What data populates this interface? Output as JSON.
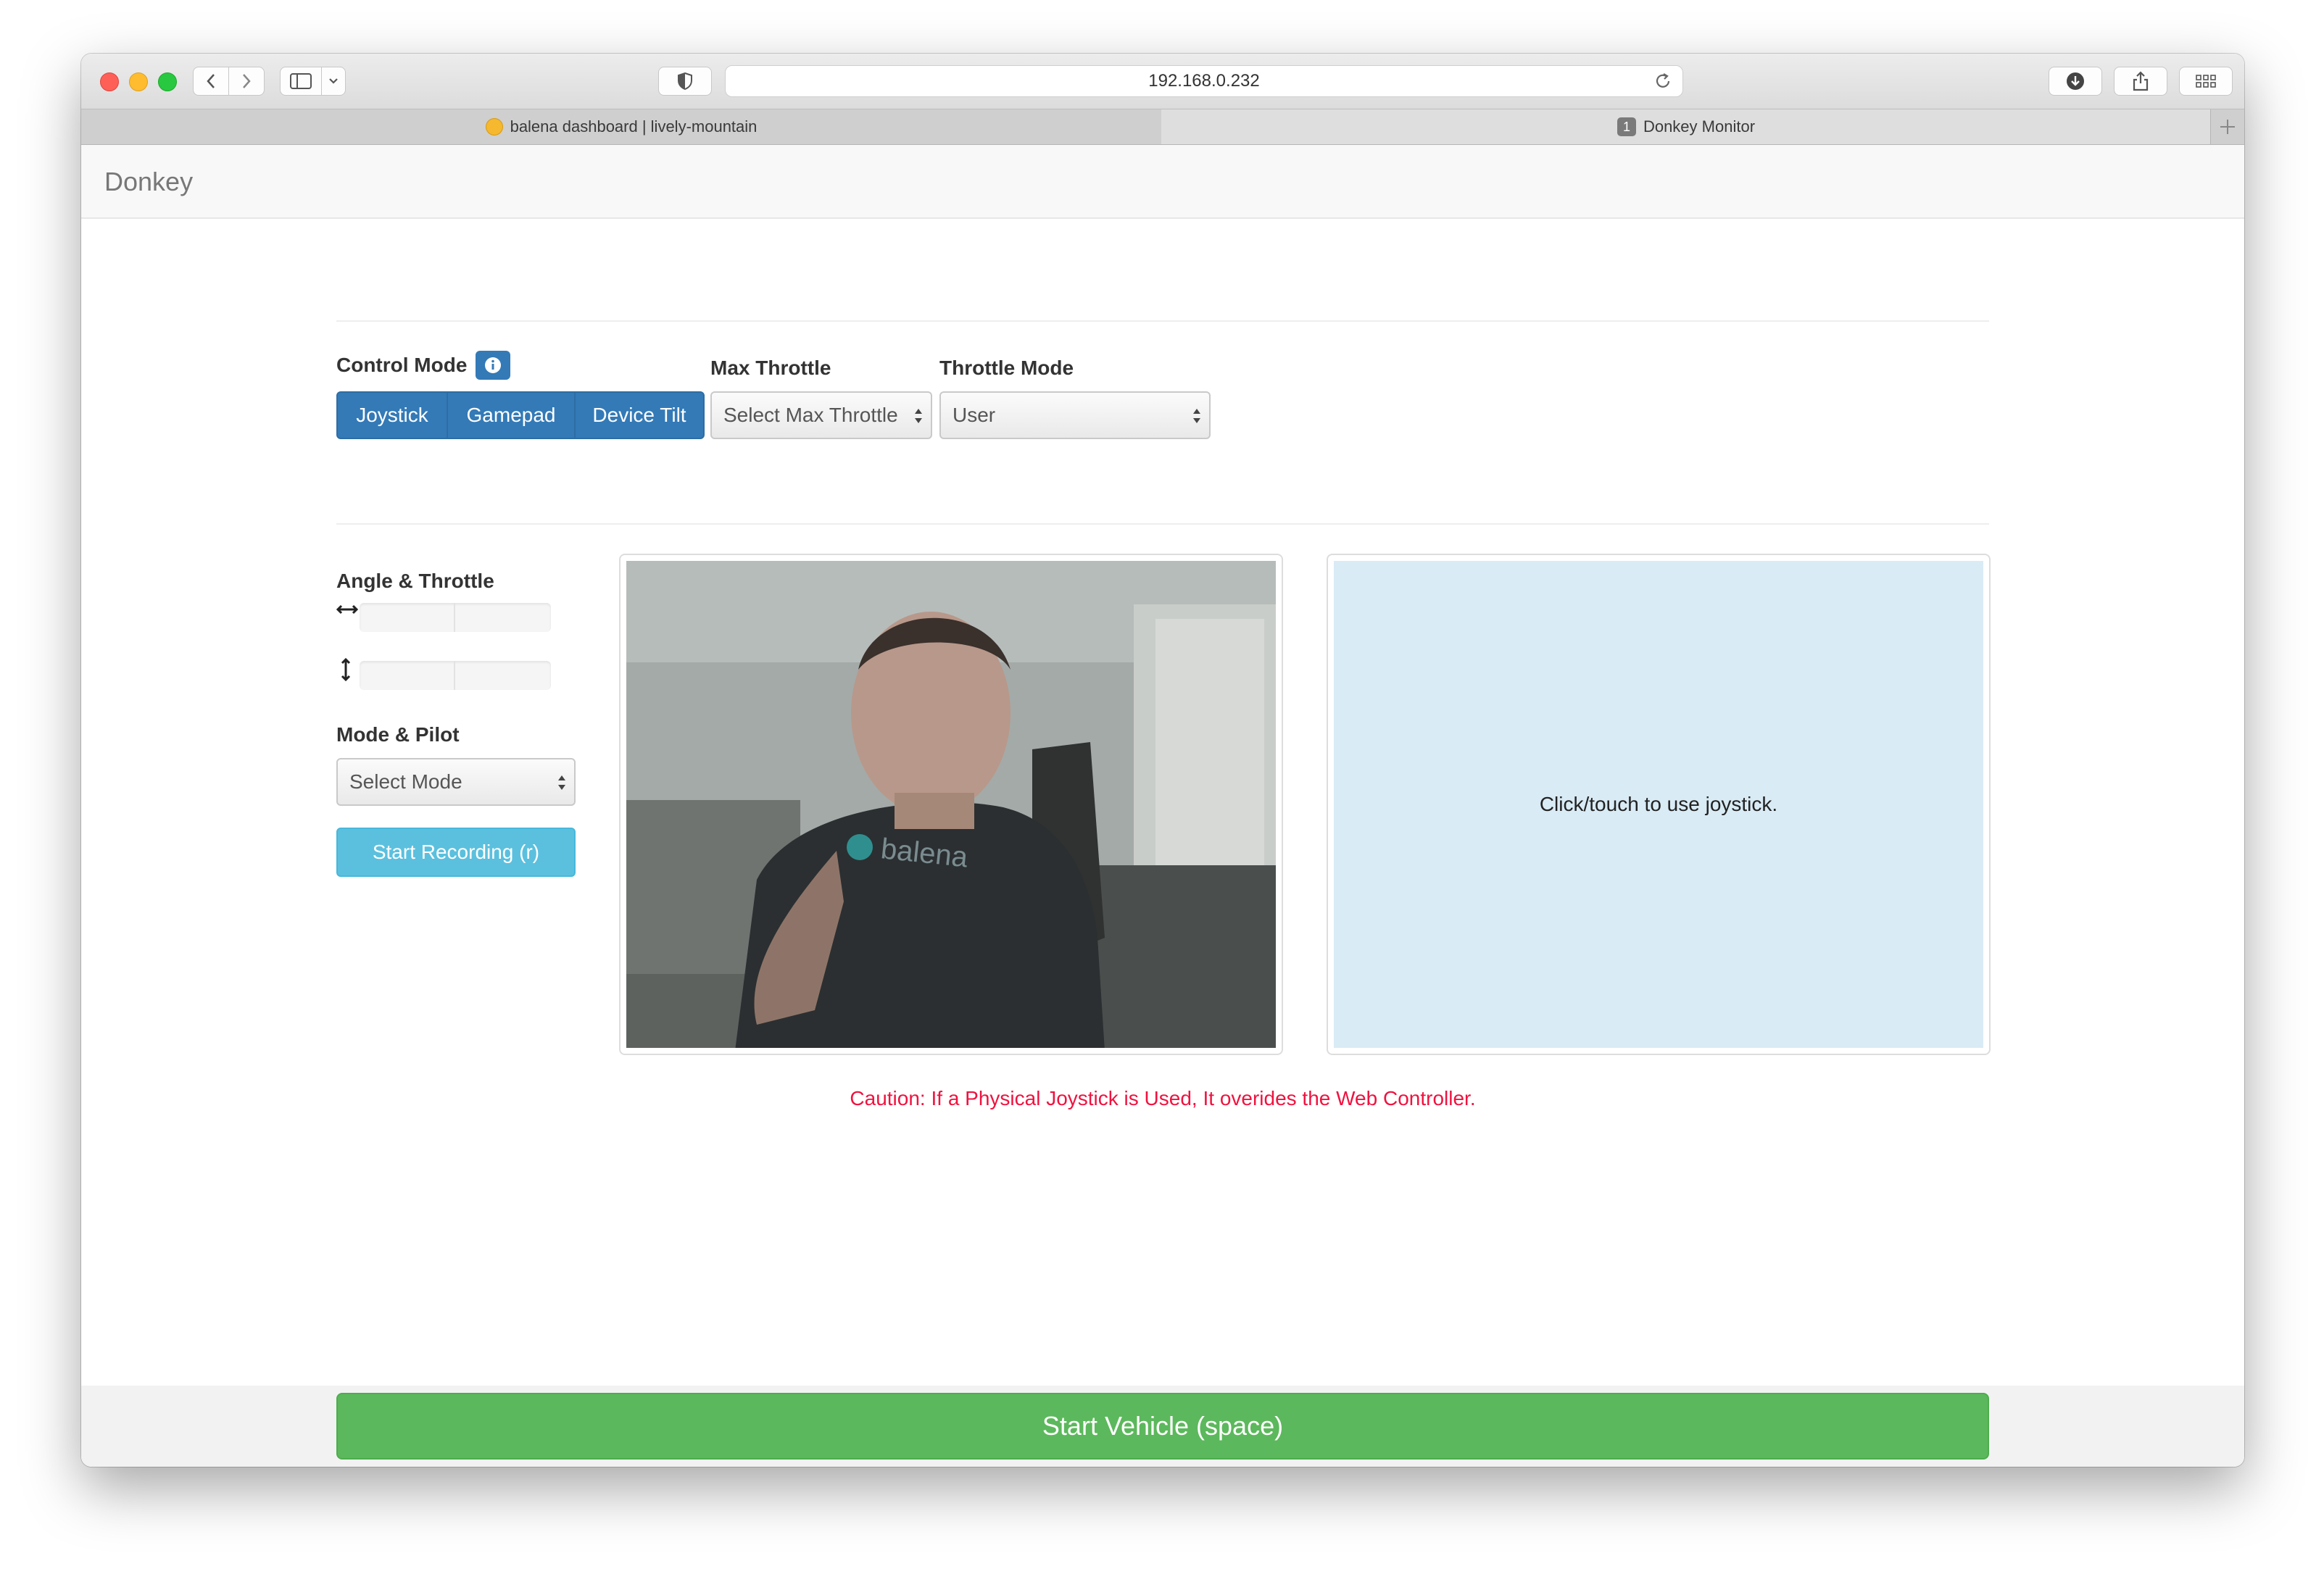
{
  "browser": {
    "url": "192.168.0.232",
    "tabs": [
      {
        "label": "balena dashboard | lively-mountain"
      },
      {
        "label": "Donkey Monitor",
        "badge": "1"
      }
    ]
  },
  "navbar": {
    "brand": "Donkey"
  },
  "controls": {
    "control_mode_label": "Control Mode",
    "control_modes": [
      "Joystick",
      "Gamepad",
      "Device Tilt"
    ],
    "max_throttle_label": "Max Throttle",
    "max_throttle_selected": "Select Max Throttle",
    "throttle_mode_label": "Throttle Mode",
    "throttle_mode_selected": "User"
  },
  "telemetry": {
    "angle_throttle_label": "Angle & Throttle",
    "angle_value": 0,
    "throttle_value": 0
  },
  "mode_pilot": {
    "label": "Mode & Pilot",
    "selected": "Select Mode",
    "record_button": "Start Recording (r)"
  },
  "joystick_pad": {
    "hint": "Click/touch to use joystick."
  },
  "caution": "Caution: If a Physical Joystick is Used, It overides the Web Controller.",
  "start_button": "Start Vehicle (space)",
  "colors": {
    "primary": "#337ab7",
    "info": "#5bc0de",
    "success": "#5cb85c",
    "caution": "#f0123f",
    "joystick_bg": "#d9ebf5"
  }
}
